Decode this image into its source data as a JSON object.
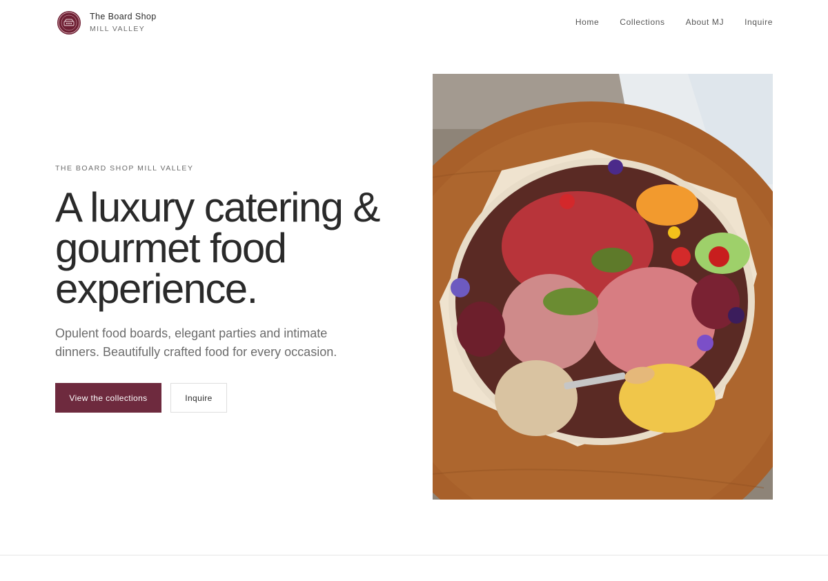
{
  "brand": {
    "name": "The Board Shop",
    "location": "MILL VALLEY",
    "logo_icon": "round-emblem-logo",
    "accent_color": "#6e1f33"
  },
  "nav": {
    "items": [
      {
        "label": "Home"
      },
      {
        "label": "Collections"
      },
      {
        "label": "About MJ"
      },
      {
        "label": "Inquire"
      }
    ]
  },
  "hero": {
    "eyebrow": "THE BOARD SHOP MILL VALLEY",
    "title": "A luxury catering & gourmet food experience.",
    "description": "Opulent food boards, elegant parties and intimate dinners. Beautifully crafted food for every occasion.",
    "primary_button": "View the collections",
    "secondary_button": "Inquire",
    "button_color": "#6e2a3e"
  }
}
